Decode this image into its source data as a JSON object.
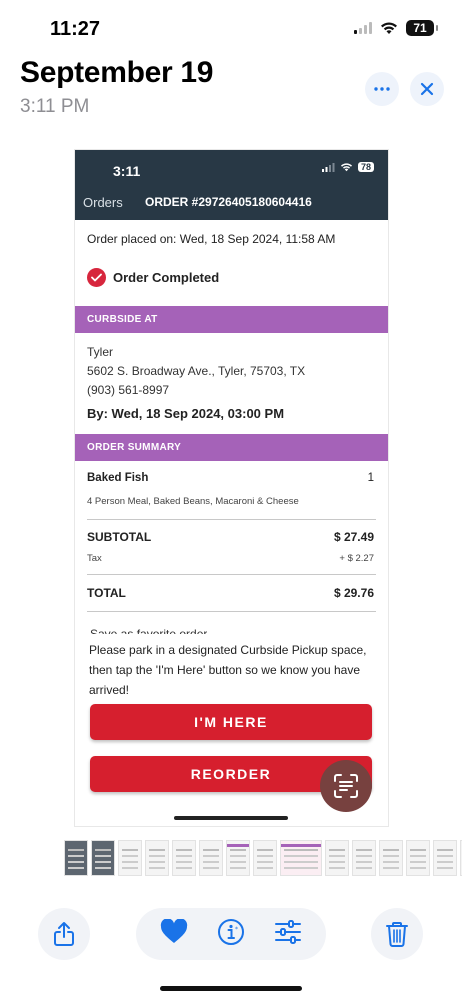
{
  "status_bar": {
    "time": "11:27",
    "battery": "71"
  },
  "photo": {
    "title": "September 19",
    "subtitle": "3:11 PM"
  },
  "screenshot": {
    "status_time": "3:11",
    "battery": "78",
    "nav_orders": "Orders",
    "nav_order_number": "ORDER #29726405180604416",
    "placed": "Order placed on: Wed, 18 Sep 2024, 11:58 AM",
    "status": "Order Completed",
    "curbside_header": "CURBSIDE AT",
    "address": [
      "Tyler",
      "5602 S. Broadway Ave., Tyler, 75703, TX",
      "(903) 561-8997"
    ],
    "by": "By: Wed, 18 Sep 2024, 03:00 PM",
    "summary_header": "ORDER SUMMARY",
    "item": {
      "name": "Baked Fish",
      "qty": "1",
      "desc": "4 Person Meal, Baked Beans, Macaroni & Cheese"
    },
    "subtotal_label": "SUBTOTAL",
    "subtotal_value": "$ 27.49",
    "tax_label": "Tax",
    "tax_value": "+ $ 2.27",
    "total_label": "TOTAL",
    "total_value": "$ 29.76",
    "save_favorite": "Save as favorite order",
    "notice": "Please park in a designated Curbside Pickup space, then tap the 'I'm Here' button so we know you have arrived!",
    "btn_here": "I'M HERE",
    "btn_reorder": "REORDER"
  },
  "colors": {
    "accent_blue": "#1a73e8",
    "header_dark": "#283845",
    "section_purple": "#a562b8",
    "button_red": "#d61f2e"
  },
  "icons": [
    "more-icon",
    "close-icon",
    "wifi-icon",
    "signal-icon",
    "check-icon",
    "live-text-icon",
    "share-icon",
    "heart-icon",
    "info-icon",
    "adjust-icon",
    "trash-icon"
  ]
}
